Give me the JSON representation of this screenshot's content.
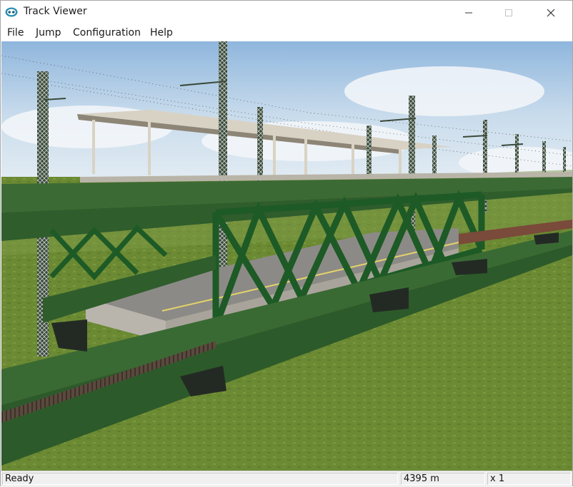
{
  "window": {
    "title": "Track Viewer"
  },
  "menu": {
    "file": "File",
    "jump": "Jump",
    "configuration": "Configuration",
    "help": "Help"
  },
  "status": {
    "message": "Ready",
    "distance": "4395 m",
    "speed_multiplier": "x 1"
  },
  "icons": {
    "app": "train-viewer-icon",
    "minimize": "minimize-icon",
    "maximize": "maximize-icon",
    "close": "close-icon"
  },
  "colors": {
    "girder": "#2f5d2c",
    "truss": "#1d5a26",
    "grass": "#6f8a35",
    "sky": "#a9c8e4"
  }
}
